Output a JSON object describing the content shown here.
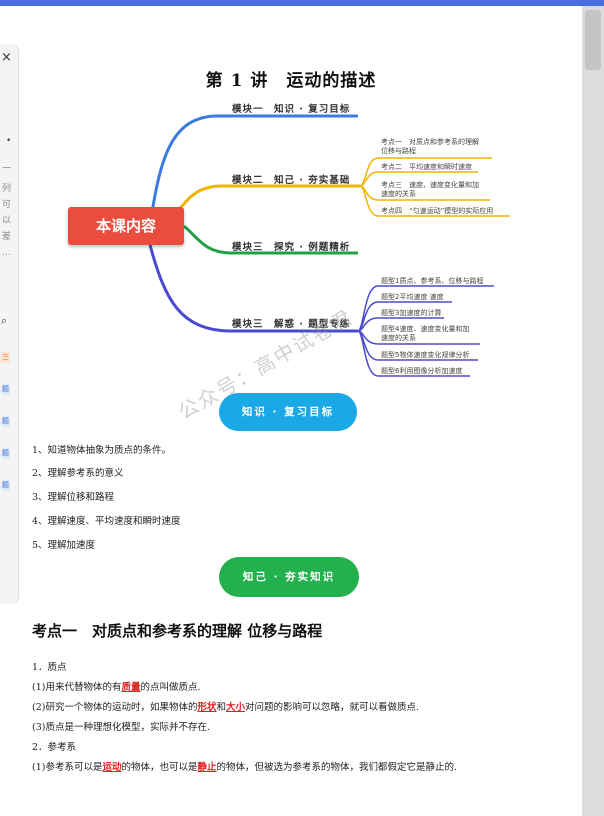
{
  "sidebar": {
    "close_icon": "×",
    "bullet": "•",
    "fragments": [
      "一",
      "列",
      "可",
      "以",
      "差",
      "…"
    ],
    "search_icon": "⌕",
    "tags": [
      "三",
      "题",
      "题",
      "题",
      "题"
    ]
  },
  "doc": {
    "title": "第 1 讲　运动的描述",
    "mindmap": {
      "core": "本课内容",
      "branches": [
        {
          "label": "模块一　知识 · 复习目标",
          "color": "#3b7ae0"
        },
        {
          "label": "模块二　知己 · 夯实基础",
          "color": "#f0b400"
        },
        {
          "label": "模块三　探究 · 例题精析",
          "color": "#22a047"
        },
        {
          "label": "模块三　解惑 · 题型专练",
          "color": "#4a4ad0"
        }
      ],
      "kaodian": [
        "考点一　对质点和参考系的理解\n位移与路程",
        "考点二　平均速度和瞬时速度",
        "考点三　速度、速度变化量和加\n速度的关系",
        "考点四　“匀速运动”模型的实际应用"
      ],
      "tixing": [
        "题型1质点、参考系、位移与路程",
        "题型2平均速度 速度",
        "题型3加速度的计算",
        "题型4速度、速度变化量和加\n速度的关系",
        "题型5物体速度变化规律分析",
        "题型6利用图像分析加速度"
      ]
    },
    "pill_review": "知识 · 复习目标",
    "watermark": "公众号：高中试卷君",
    "goals": [
      "1、知道物体抽象为质点的条件。",
      "2、理解参考系的意义",
      "3、理解位移和路程",
      "4、理解速度、平均速度和瞬时速度",
      "5、理解加速度"
    ],
    "pill_basics": "知己 · 夯实知识",
    "section_heading": "考点一　对质点和参考系的理解 位移与路程",
    "p1": "1．质点",
    "p1a": {
      "a": "(1)用来代替物体的有",
      "r": "质量",
      "b": "的点叫做质点."
    },
    "p1b": {
      "a": "(2)研究一个物体的运动时，如果物体的",
      "r1": "形状",
      "m": "和",
      "r2": "大小",
      "b": "对问题的影响可以忽略，就可以看做质点."
    },
    "p1c": "(3)质点是一种理想化模型，实际并不存在.",
    "p2": "2．参考系",
    "p2a": {
      "a": "(1)参考系可以是",
      "r1": "运动",
      "m": "的物体，也可以是",
      "r2": "静止",
      "b": "的物体，但被选为参考系的物体，我们都假定它是静止的."
    }
  }
}
